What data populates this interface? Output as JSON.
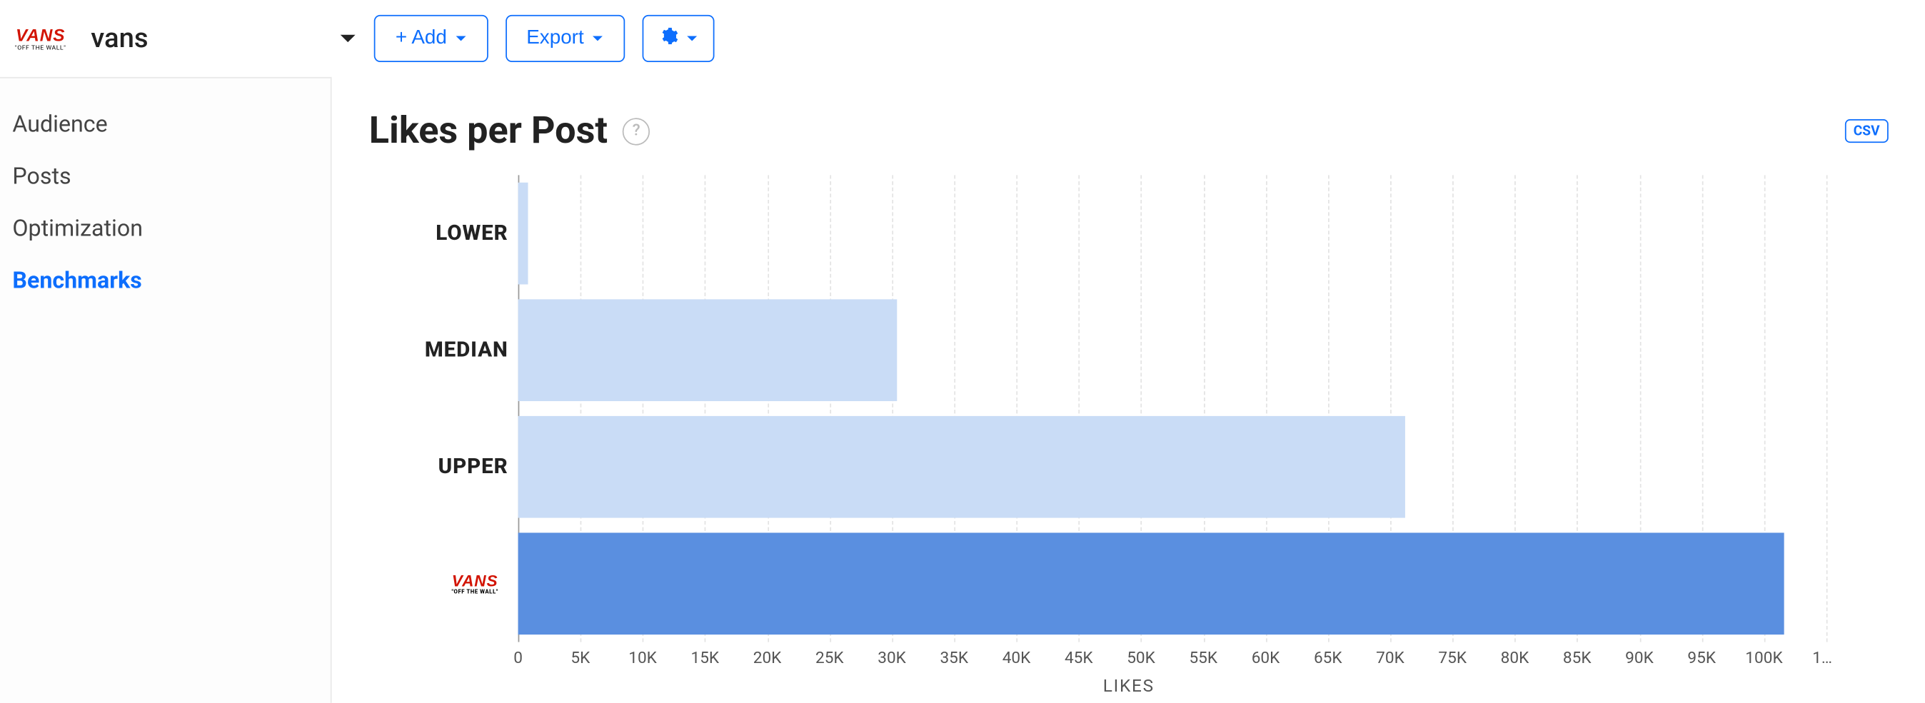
{
  "header": {
    "brand_name": "vans",
    "brand_logo_text": "VANS",
    "brand_logo_sub": "\"OFF THE WALL\"",
    "add_btn": "+ Add",
    "export_btn": "Export"
  },
  "sidebar": {
    "items": [
      {
        "label": "Audience",
        "active": false
      },
      {
        "label": "Posts",
        "active": false
      },
      {
        "label": "Optimization",
        "active": false
      },
      {
        "label": "Benchmarks",
        "active": true
      }
    ]
  },
  "main": {
    "title": "Likes per Post",
    "csv_label": "CSV"
  },
  "chart_data": {
    "type": "bar",
    "orientation": "horizontal",
    "categories": [
      "LOWER",
      "MEDIAN",
      "UPPER",
      "vans"
    ],
    "values": [
      800,
      29000,
      68000,
      97000
    ],
    "colors": [
      "#c9dcf6",
      "#c9dcf6",
      "#c9dcf6",
      "#5a8fe0"
    ],
    "xlabel": "LIKES",
    "xlim": [
      0,
      105000
    ],
    "xticks": [
      "0",
      "5K",
      "10K",
      "15K",
      "20K",
      "25K",
      "30K",
      "35K",
      "40K",
      "45K",
      "50K",
      "55K",
      "60K",
      "65K",
      "70K",
      "75K",
      "80K",
      "85K",
      "90K",
      "95K",
      "100K",
      "1…"
    ]
  }
}
